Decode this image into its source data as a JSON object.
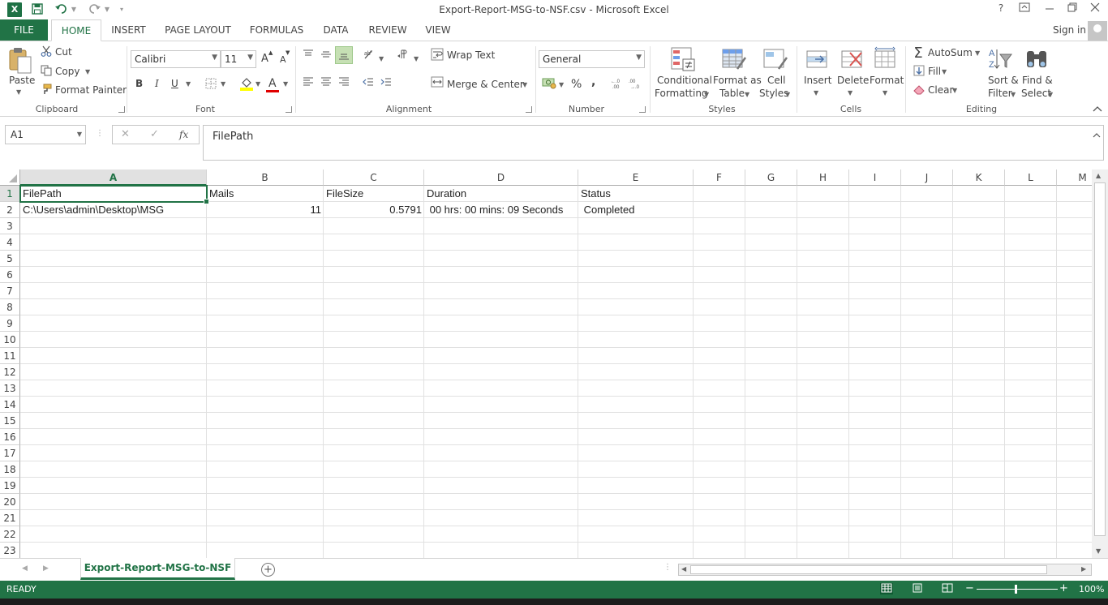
{
  "window": {
    "title": "Export-Report-MSG-to-NSF.csv - Microsoft Excel",
    "help": "?",
    "logo_letter": "X"
  },
  "tabs": {
    "file": "FILE",
    "items": [
      "HOME",
      "INSERT",
      "PAGE LAYOUT",
      "FORMULAS",
      "DATA",
      "REVIEW",
      "VIEW"
    ],
    "active": "HOME",
    "signin": "Sign in"
  },
  "ribbon": {
    "clipboard": {
      "label": "Clipboard",
      "paste": "Paste",
      "cut": "Cut",
      "copy": "Copy",
      "format_painter": "Format Painter"
    },
    "font": {
      "label": "Font",
      "font_name": "Calibri",
      "font_size": "11",
      "bold": "B",
      "italic": "I",
      "underline": "U",
      "font_color_letter": "A",
      "grow": "A",
      "shrink": "A"
    },
    "alignment": {
      "label": "Alignment",
      "wrap_text": "Wrap Text",
      "merge_center": "Merge & Center"
    },
    "number": {
      "label": "Number",
      "format": "General",
      "percent": "%",
      "comma": ","
    },
    "styles": {
      "label": "Styles",
      "conditional_1": "Conditional",
      "conditional_2": "Formatting",
      "format_table_1": "Format as",
      "format_table_2": "Table",
      "cell_styles_1": "Cell",
      "cell_styles_2": "Styles"
    },
    "cells": {
      "label": "Cells",
      "insert": "Insert",
      "delete": "Delete",
      "format": "Format"
    },
    "editing": {
      "label": "Editing",
      "autosum": "AutoSum",
      "fill": "Fill",
      "clear": "Clear",
      "sort_1": "Sort &",
      "sort_2": "Filter",
      "find_1": "Find &",
      "find_2": "Select"
    }
  },
  "formula_bar": {
    "name_box": "A1",
    "fx": "fx",
    "content": "FilePath"
  },
  "grid": {
    "columns": [
      "A",
      "B",
      "C",
      "D",
      "E",
      "F",
      "G",
      "H",
      "I",
      "J",
      "K",
      "L",
      "M"
    ],
    "rows": [
      "1",
      "2",
      "3",
      "4",
      "5",
      "6",
      "7",
      "8",
      "9",
      "10",
      "11",
      "12",
      "13",
      "14",
      "15",
      "16",
      "17",
      "18",
      "19",
      "20",
      "21",
      "22",
      "23"
    ],
    "selected_cell": "A1",
    "cells": {
      "a1": "FilePath",
      "b1": "Mails",
      "c1": "FileSize",
      "d1": "Duration",
      "e1": "Status",
      "a2": "C:\\Users\\admin\\Desktop\\MSG",
      "b2": "11",
      "c2": "0.5791",
      "d2": " 00 hrs: 00 mins: 09 Seconds",
      "e2": " Completed"
    }
  },
  "sheets": {
    "active": "Export-Report-MSG-to-NSF",
    "add": "+"
  },
  "status": {
    "mode": "READY",
    "zoom": "100%",
    "zoom_minus": "−",
    "zoom_plus": "+"
  },
  "colors": {
    "accent": "#217346",
    "status_bar": "#217346",
    "grid_line": "#e1e1e1"
  }
}
